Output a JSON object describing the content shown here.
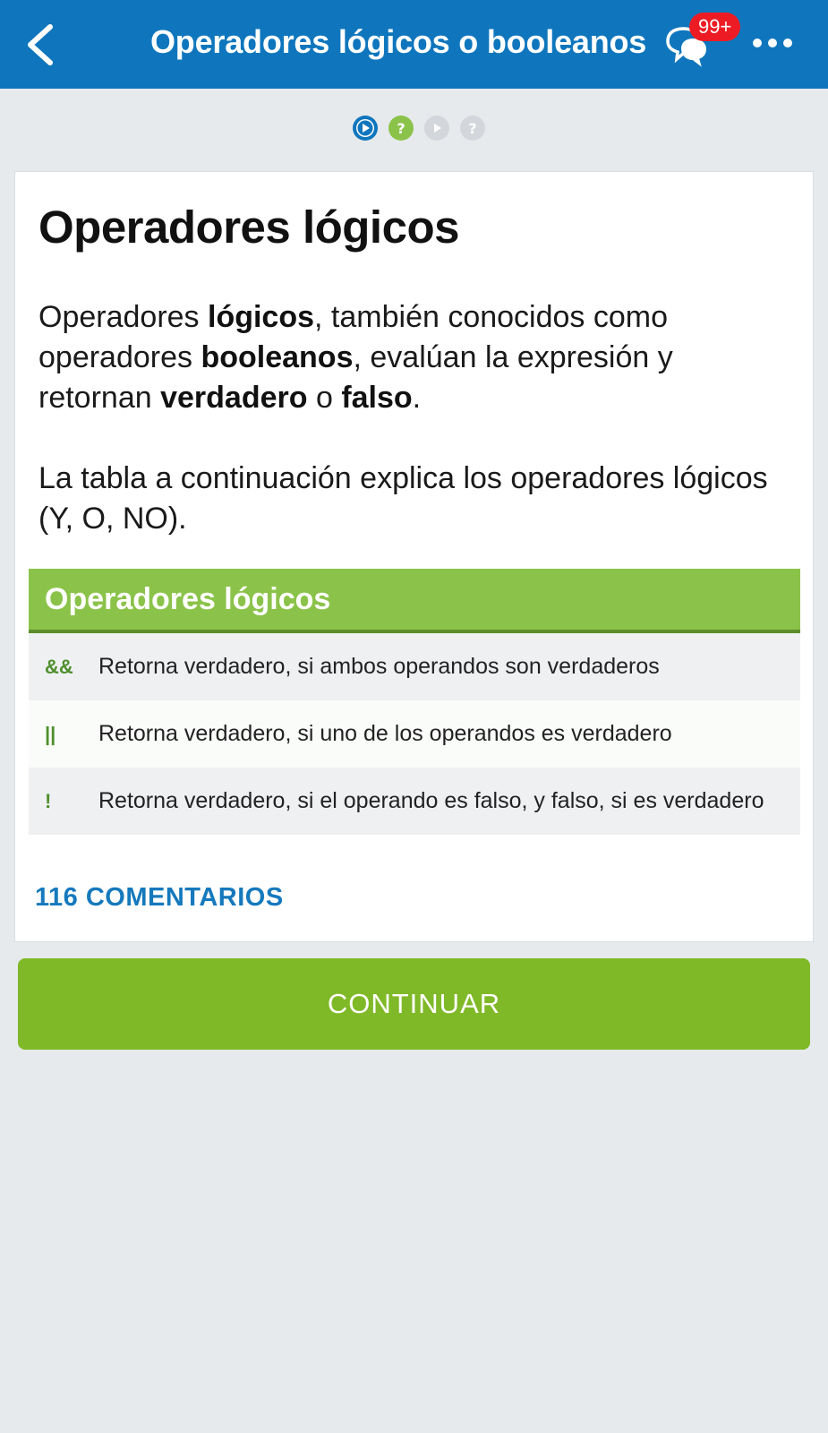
{
  "header": {
    "title": "Operadores lógicos o booleanos",
    "badge": "99+",
    "back_icon": "chevron-left-icon",
    "chat_icon": "chat-bubbles-icon",
    "more_icon": "more-dots-icon",
    "bg_color": "#0f76bd"
  },
  "progress": {
    "steps": [
      {
        "type": "lesson",
        "state": "current",
        "icon": "play-icon"
      },
      {
        "type": "quiz",
        "state": "available",
        "icon": "question-icon"
      },
      {
        "type": "lesson",
        "state": "locked",
        "icon": "play-icon"
      },
      {
        "type": "quiz",
        "state": "locked",
        "icon": "question-icon"
      }
    ]
  },
  "lesson": {
    "heading": "Operadores lógicos",
    "para1": {
      "t1": "Operadores ",
      "b1": "lógicos",
      "t2": ", también conocidos como operadores ",
      "b2": "booleanos",
      "t3": ", evalúan la expresión y retornan ",
      "b3": "verdadero",
      "t4": " o ",
      "b4": "falso",
      "t5": "."
    },
    "para2": "La tabla a continuación explica los operadores lógicos (Y, O, NO).",
    "table": {
      "title": "Operadores lógicos",
      "rows": [
        {
          "symbol": "&&",
          "desc": "Retorna verdadero, si ambos operandos son verdaderos"
        },
        {
          "symbol": "||",
          "desc": "Retorna verdadero, si uno de los operandos es verdadero"
        },
        {
          "symbol": "!",
          "desc": "Retorna verdadero, si el operando es falso, y falso, si es verdadero"
        }
      ]
    },
    "comments": "116 COMENTARIOS"
  },
  "footer": {
    "continue_label": "CONTINUAR",
    "accent": "#7fb927"
  }
}
